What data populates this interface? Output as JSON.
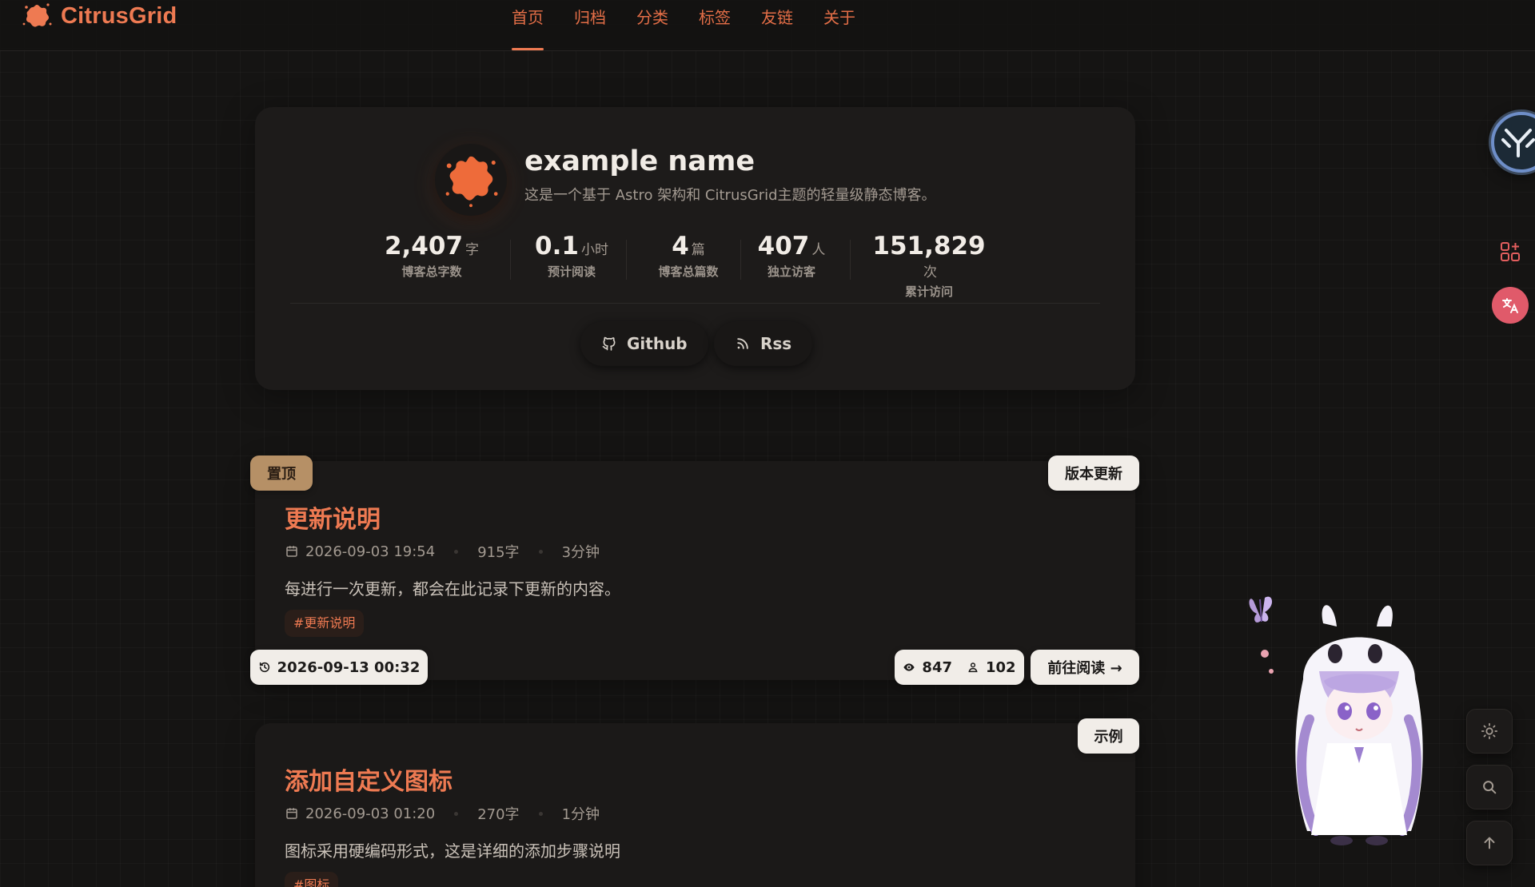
{
  "site": {
    "logo_text": "CitrusGrid",
    "accent": "#ee7a52"
  },
  "nav": {
    "items": [
      "首页",
      "归档",
      "分类",
      "标签",
      "友链",
      "关于"
    ],
    "active_index": 0
  },
  "profile": {
    "name": "example name",
    "description": "这是一个基于 Astro 架构和 CitrusGrid主题的轻量级静态博客。",
    "stats": [
      {
        "value": "2,407",
        "unit": "字",
        "label": "博客总字数"
      },
      {
        "value": "0.1",
        "unit": "小时",
        "label": "预计阅读"
      },
      {
        "value": "4",
        "unit": "篇",
        "label": "博客总篇数"
      },
      {
        "value": "407",
        "unit": "人",
        "label": "独立访客"
      },
      {
        "value": "151,829",
        "unit": "次",
        "label": "累计访问"
      }
    ],
    "social": [
      {
        "label": "Github",
        "icon": "github-icon"
      },
      {
        "label": "Rss",
        "icon": "rss-icon"
      }
    ]
  },
  "posts": [
    {
      "pinned_label": "置顶",
      "category": "版本更新",
      "title": "更新说明",
      "date": "2026-09-03 19:54",
      "words": "915字",
      "read_time": "3分钟",
      "excerpt": "每进行一次更新，都会在此记录下更新的内容。",
      "tag": "#更新说明",
      "updated": "2026-09-13 00:32",
      "views": "847",
      "visitors": "102",
      "read_more": "前往阅读 →"
    },
    {
      "category": "示例",
      "title": "添加自定义图标",
      "date": "2026-09-03 01:20",
      "words": "270字",
      "read_time": "1分钟",
      "excerpt": "图标采用硬编码形式，这是详细的添加步骤说明",
      "tag": "#图标"
    }
  ],
  "floating": {
    "icons": [
      "blog-avatar-icon",
      "apps-icon",
      "translate-icon",
      "sun-icon",
      "search-icon",
      "arrow-up-icon"
    ]
  }
}
